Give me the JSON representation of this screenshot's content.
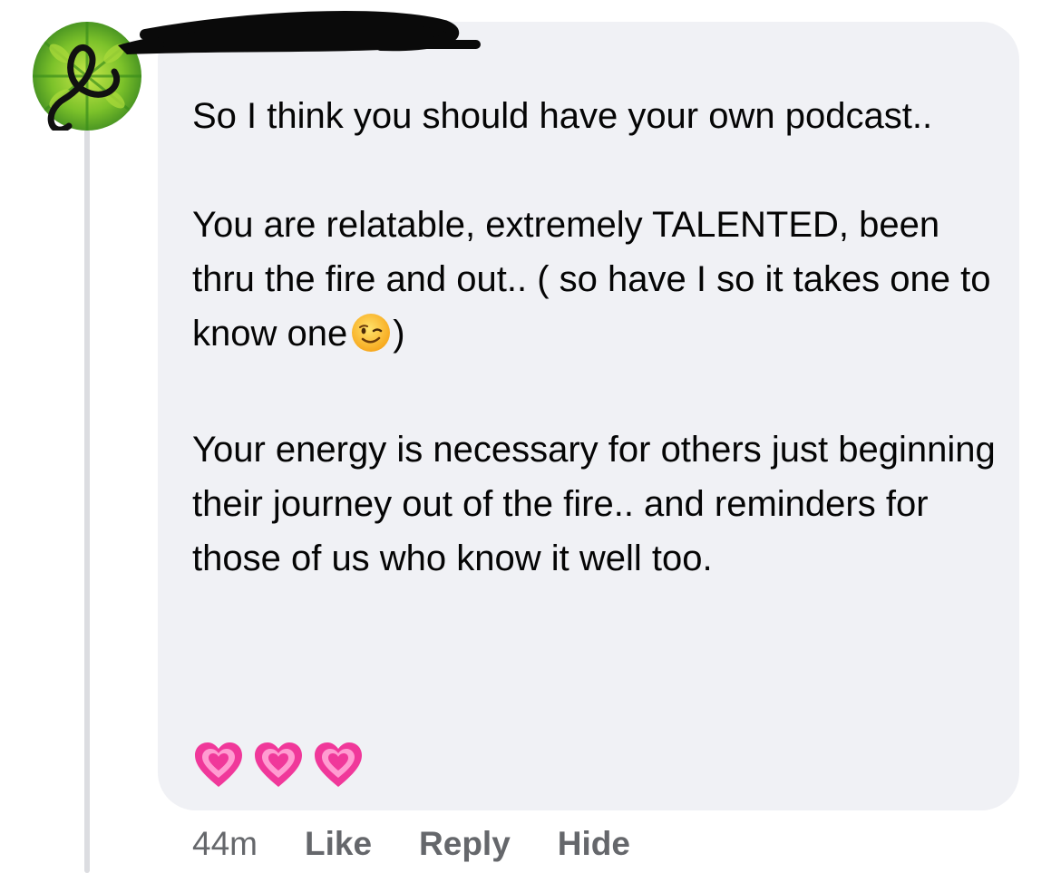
{
  "comment": {
    "paragraphs": [
      "So I think you should have your own podcast..",
      "You are relatable, extremely TALENTED, been thru the fire and out.. ( so have I so it takes one to know one",
      "Your energy is necessary for others just beginning their journey out of the fire.. and reminders for those of us who know it well too."
    ],
    "paragraph2_after_emoji": ")",
    "emoji": "winking-face-icon",
    "reactions_line": [
      "growing-heart-icon",
      "growing-heart-icon",
      "growing-heart-icon"
    ]
  },
  "actions": {
    "time": "44m",
    "like_label": "Like",
    "reply_label": "Reply",
    "hide_label": "Hide"
  },
  "colors": {
    "bubble": "#f0f1f5",
    "text": "#050505",
    "meta": "#65676b",
    "heart": "#f0389a"
  }
}
